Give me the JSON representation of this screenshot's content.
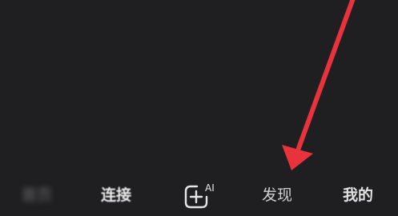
{
  "tabbar": {
    "tabs": [
      {
        "id": "home",
        "label": "首页"
      },
      {
        "id": "connect",
        "label": "连接"
      },
      {
        "id": "create",
        "label": "",
        "icon": "add-ai-icon",
        "badge": "AI"
      },
      {
        "id": "discover",
        "label": "发现"
      },
      {
        "id": "mine",
        "label": "我的"
      }
    ]
  },
  "annotation": {
    "icon": "arrow-annotation",
    "color": "#e8323c"
  },
  "colors": {
    "background": "#1f1f21",
    "tab_text": "#d4d4d4"
  }
}
